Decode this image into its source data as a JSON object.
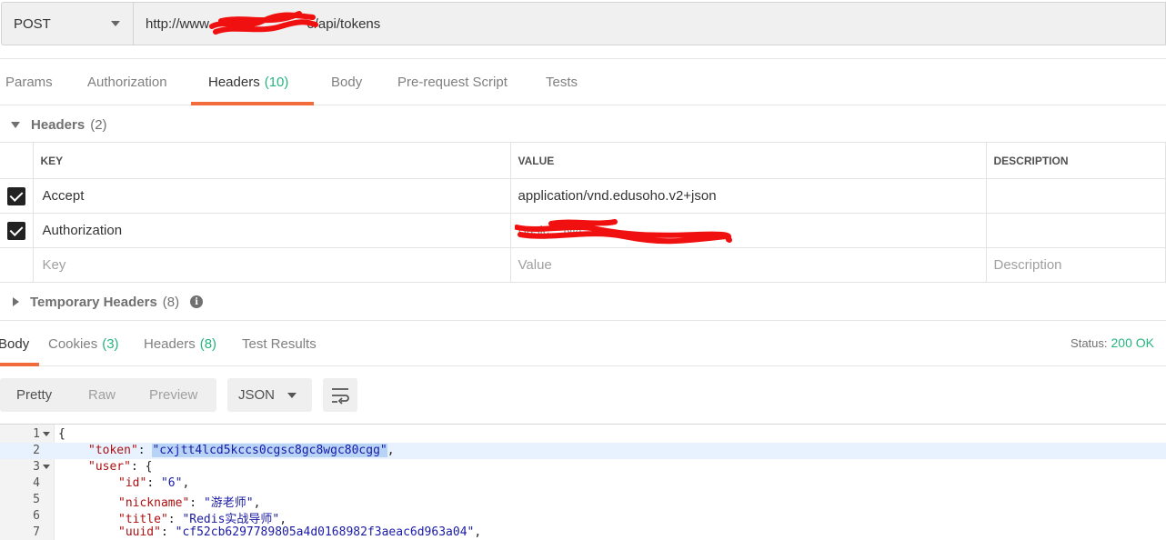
{
  "request": {
    "method": "POST",
    "url_prefix": "http://www.",
    "url_suffix": "o/api/tokens"
  },
  "request_tabs": [
    {
      "label": "Params",
      "count": ""
    },
    {
      "label": "Authorization",
      "count": ""
    },
    {
      "label": "Headers",
      "count": "(10)"
    },
    {
      "label": "Body",
      "count": ""
    },
    {
      "label": "Pre-request Script",
      "count": ""
    },
    {
      "label": "Tests",
      "count": ""
    }
  ],
  "headers_section": {
    "title": "Headers",
    "count": "(2)",
    "columns": {
      "key": "KEY",
      "value": "VALUE",
      "description": "DESCRIPTION"
    },
    "rows": [
      {
        "checked": true,
        "key": "Accept",
        "value": "application/vnd.edusoho.v2+json",
        "description": ""
      },
      {
        "checked": true,
        "key": "Authorization",
        "value": "Basic ...Ni4=",
        "description": ""
      }
    ],
    "placeholders": {
      "key": "Key",
      "value": "Value",
      "description": "Description"
    }
  },
  "temporary_headers": {
    "title": "Temporary Headers",
    "count": "(8)"
  },
  "response_tabs": [
    {
      "label": "Body",
      "count": ""
    },
    {
      "label": "Cookies",
      "count": "(3)"
    },
    {
      "label": "Headers",
      "count": "(8)"
    },
    {
      "label": "Test Results",
      "count": ""
    }
  ],
  "status": {
    "label": "Status:",
    "value": "200 OK"
  },
  "viewer": {
    "modes": [
      "Pretty",
      "Raw",
      "Preview"
    ],
    "active_mode": "Pretty",
    "format": "JSON"
  },
  "code_lines": [
    {
      "n": "1",
      "fold": true,
      "indent": 0,
      "key": "",
      "value": "",
      "raw": "{"
    },
    {
      "n": "2",
      "fold": false,
      "indent": 1,
      "key": "\"token\"",
      "value": "\"cxjtt4lcd5kccs0cgsc8gc8wgc80cgg\"",
      "raw": ""
    },
    {
      "n": "3",
      "fold": true,
      "indent": 1,
      "key": "\"user\"",
      "value": "",
      "raw": "{"
    },
    {
      "n": "4",
      "fold": false,
      "indent": 2,
      "key": "\"id\"",
      "value": "\"6\"",
      "raw": ""
    },
    {
      "n": "5",
      "fold": false,
      "indent": 2,
      "key": "\"nickname\"",
      "value": "\"游老师\"",
      "raw": ""
    },
    {
      "n": "6",
      "fold": false,
      "indent": 2,
      "key": "\"title\"",
      "value": "\"Redis实战导师\"",
      "raw": ""
    },
    {
      "n": "7",
      "fold": false,
      "indent": 2,
      "key": "\"uuid\"",
      "value": "\"cf52cb6297789805a4d0168982f3aeac6d963a04\"",
      "raw": ""
    }
  ]
}
